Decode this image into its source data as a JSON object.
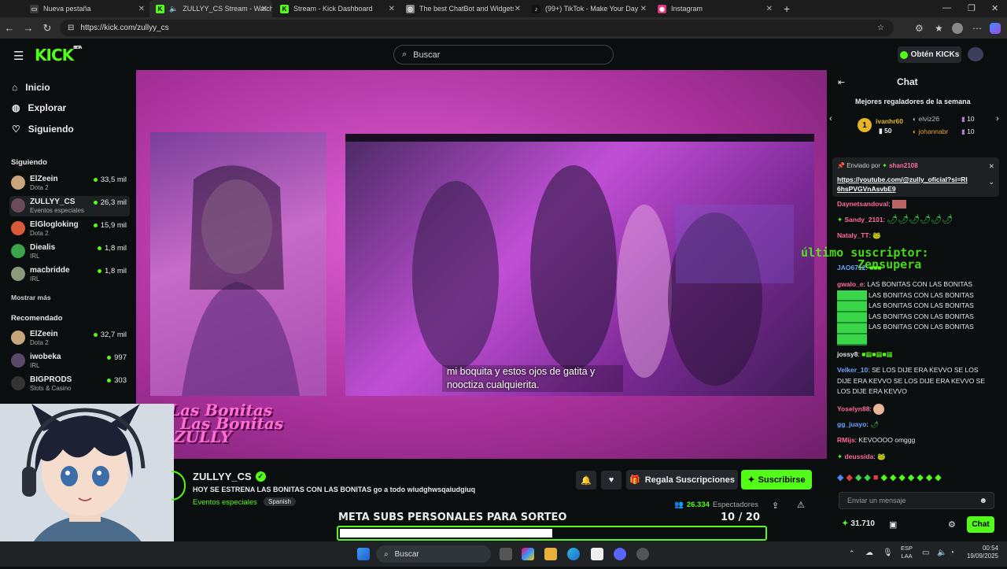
{
  "browser": {
    "tabs": [
      {
        "title": "Nueva pestaña"
      },
      {
        "title": "ZULLYY_CS Stream - Watch L"
      },
      {
        "title": "Stream - Kick Dashboard"
      },
      {
        "title": "The best ChatBot and Widgets fo"
      },
      {
        "title": "(99+) TikTok - Make Your Day"
      },
      {
        "title": "Instagram"
      }
    ],
    "url": "https://kick.com/zullyy_cs"
  },
  "header": {
    "logo": "KICK",
    "logo_beta": "BETA",
    "search_placeholder": "Buscar",
    "get_kicks": "Obtén KICKs"
  },
  "sidebar": {
    "nav": [
      {
        "label": "Inicio",
        "icon": "home-icon"
      },
      {
        "label": "Explorar",
        "icon": "compass-icon"
      },
      {
        "label": "Siguiendo",
        "icon": "heart-icon"
      }
    ],
    "following_title": "Siguiendo",
    "following": [
      {
        "name": "ElZeein",
        "category": "Dota 2",
        "viewers": "33,5 mil",
        "color": "#c8a57a"
      },
      {
        "name": "ZULLYY_CS",
        "category": "Eventos especiales",
        "viewers": "26,3 mil",
        "color": "#6b4a5a"
      },
      {
        "name": "ElGlogloking",
        "category": "Dota 2",
        "viewers": "15,9 mil",
        "color": "#d85a3a"
      },
      {
        "name": "Diealis",
        "category": "IRL",
        "viewers": "1,8 mil",
        "color": "#3aa54a"
      },
      {
        "name": "macbridde",
        "category": "IRL",
        "viewers": "1,8 mil",
        "color": "#8a9a7a"
      }
    ],
    "show_more": "Mostrar más",
    "recommended_title": "Recomendado",
    "recommended": [
      {
        "name": "ElZeein",
        "category": "Dota 2",
        "viewers": "32,7 mil",
        "color": "#c8a57a"
      },
      {
        "name": "iwobeka",
        "category": "IRL",
        "viewers": "997",
        "color": "#5a4a6a"
      },
      {
        "name": "BIGPRODS",
        "category": "Slots & Casino",
        "viewers": "303",
        "color": "#333333"
      }
    ]
  },
  "video": {
    "subtitle_line1": "mi boquita y estos ojos de gatita y",
    "subtitle_line2": "nooctiza cualquierita.",
    "overlay_line1": "Las Bonitas",
    "overlay_line2": "Las Bonitas",
    "overlay_line3": "ZULLY"
  },
  "stream": {
    "channel_name": "ZULLYY_CS",
    "title": "HOY SE ESTRENA LAS BONITAS CON LAS BONITAS go a todo wiudghwsqaiudgiuq",
    "category": "Eventos especiales",
    "language": "Spanish",
    "gift_label": "Regala Suscripciones",
    "subscribe_label": "Suscribirse",
    "viewers_count": "26.334",
    "viewers_label": "Espectadores",
    "goal_title": "META SUBS PERSONALES PARA SORTEO",
    "goal_current": "10",
    "goal_total": "/ 20",
    "goal_progress": 0.5
  },
  "chat": {
    "title": "Chat",
    "leaderboard_title": "Mejores regaladores de la semana",
    "leaders": [
      {
        "rank": "1",
        "name": "ivanhr60",
        "count": "50"
      },
      {
        "name": "elviz26",
        "count": "10"
      },
      {
        "name": "johannabr",
        "count": "10"
      }
    ],
    "pinned_by_label": "Enviado por",
    "pinned_by_user": "shan2108",
    "pinned_link": "https://youtube.com/@zully_oficial?si=RI6hsPVGVnAsvbE9",
    "overlay_text1": "último suscriptor:",
    "overlay_text2": "Zensupera",
    "messages": [
      {
        "user": "Daynetsandoval",
        "text": ":",
        "color": "#ff6b9b"
      },
      {
        "user": "Sandy_2101",
        "text": ":",
        "color": "#ff6b9b"
      },
      {
        "user": "Nataly_TT",
        "text": ":",
        "color": "#ff6b9b"
      },
      {
        "user": "JAO6712",
        "text": ":",
        "color": "#6ba5ff"
      },
      {
        "user": "gwalo_e",
        "text": ": LAS BONITAS CON LAS BONITAS",
        "color": "#ff6b9b"
      },
      {
        "user": "",
        "text": "LAS BONITAS CON LAS BONITAS",
        "color": "#ff6b9b"
      },
      {
        "user": "",
        "text": "LAS BONITAS CON LAS BONITAS",
        "color": "#ff6b9b"
      },
      {
        "user": "",
        "text": "LAS BONITAS CON LAS BONITAS",
        "color": "#ff6b9b"
      },
      {
        "user": "",
        "text": "LAS BONITAS CON LAS BONITAS",
        "color": "#ff6b9b"
      },
      {
        "user": "jossy8",
        "text": ":",
        "color": "#ffffff"
      },
      {
        "user": "Velker_10",
        "text": ": SE LOS DIJE ERA KEVVO SE LOS DIJE ERA KEVVO SE LOS DIJE ERA KEVVO SE LOS DIJE ERA KEVVO",
        "color": "#6ba5ff"
      },
      {
        "user": "Yoselyn88",
        "text": ":",
        "color": "#ff6b9b"
      },
      {
        "user": "gg_juayo",
        "text": ":",
        "color": "#6ba5ff"
      },
      {
        "user": "RMijs",
        "text": ": KEVOOOO omggg",
        "color": "#ff6b9b"
      },
      {
        "user": "deussida",
        "text": ":",
        "color": "#ff6b9b"
      }
    ],
    "input_placeholder": "Enviar un mensaje",
    "points": "31.710",
    "send_label": "Chat"
  },
  "taskbar": {
    "search_placeholder": "Buscar",
    "lang_line1": "ESP",
    "lang_line2": "LAA",
    "time": "00:54",
    "date": "19/09/2025"
  },
  "colors": {
    "accent": "#53fc18",
    "background": "#0b0e0f",
    "panel": "#24272c"
  }
}
